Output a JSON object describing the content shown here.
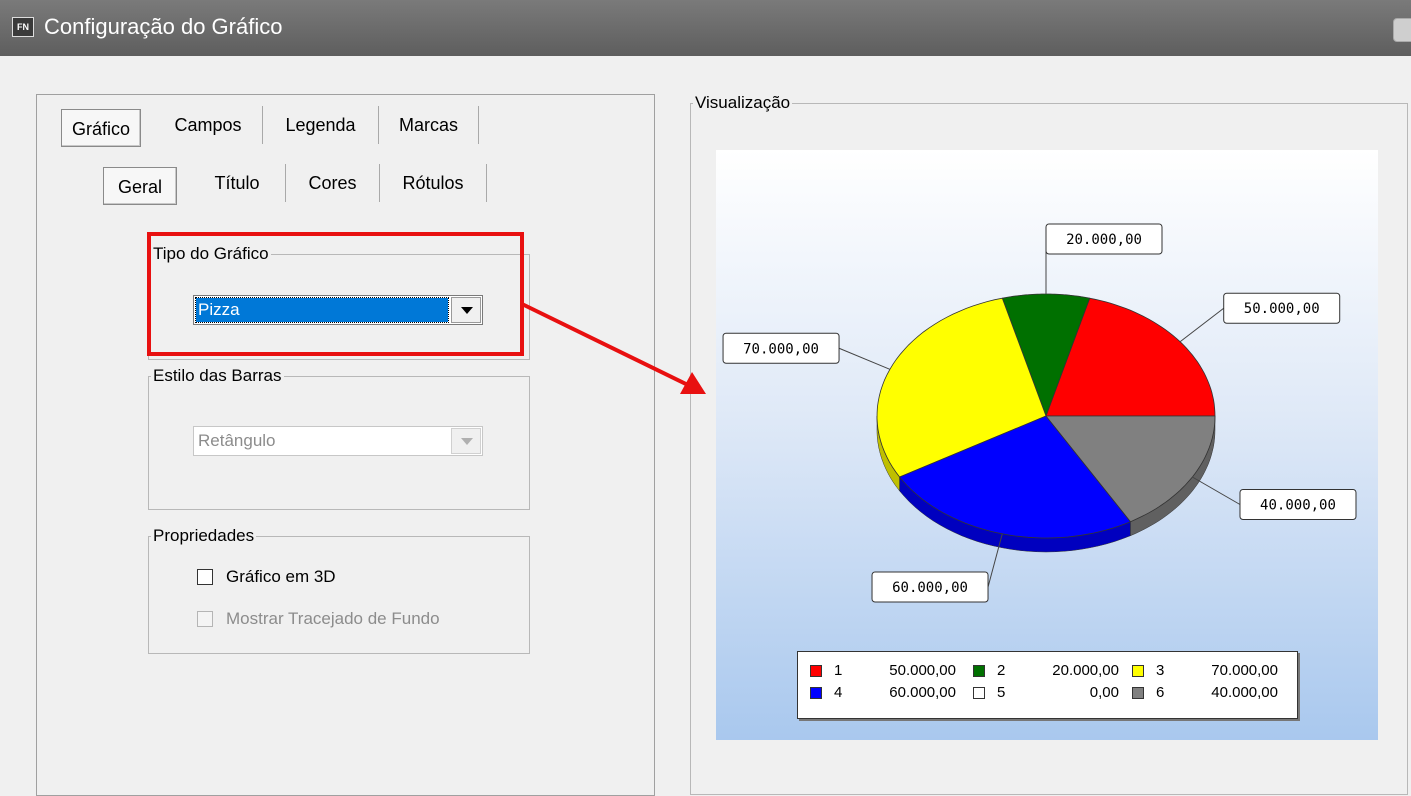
{
  "window": {
    "icon_text": "FN",
    "title": "Configuração do Gráfico"
  },
  "tabs_main": [
    {
      "label": "Gráfico",
      "active": true
    },
    {
      "label": "Campos",
      "active": false
    },
    {
      "label": "Legenda",
      "active": false
    },
    {
      "label": "Marcas",
      "active": false
    }
  ],
  "tabs_sub": [
    {
      "label": "Geral",
      "active": true
    },
    {
      "label": "Título",
      "active": false
    },
    {
      "label": "Cores",
      "active": false
    },
    {
      "label": "Rótulos",
      "active": false
    }
  ],
  "tipo_grafico": {
    "legend": "Tipo do Gráfico",
    "selected": "Pizza"
  },
  "estilo_barras": {
    "legend": "Estilo das Barras",
    "selected": "Retângulo",
    "enabled": false
  },
  "propriedades": {
    "legend": "Propriedades",
    "grafico_3d": {
      "label": "Gráfico em 3D",
      "checked": false,
      "enabled": true
    },
    "tracejado": {
      "label": "Mostrar Tracejado de Fundo",
      "checked": false,
      "enabled": false
    }
  },
  "preview": {
    "legend": "Visualização"
  },
  "annotation_color": "#e81010",
  "chart_data": {
    "type": "pie",
    "three_d": true,
    "categories": [
      "1",
      "2",
      "3",
      "4",
      "5",
      "6"
    ],
    "values": [
      50000,
      20000,
      70000,
      60000,
      0,
      40000
    ],
    "value_labels": [
      "50.000,00",
      "20.000,00",
      "70.000,00",
      "60.000,00",
      "0,00",
      "40.000,00"
    ],
    "colors": [
      "#ff0000",
      "#007000",
      "#ffff00",
      "#0000ff",
      "#ffffff",
      "#808080"
    ],
    "legend_position": "bottom",
    "title": ""
  }
}
